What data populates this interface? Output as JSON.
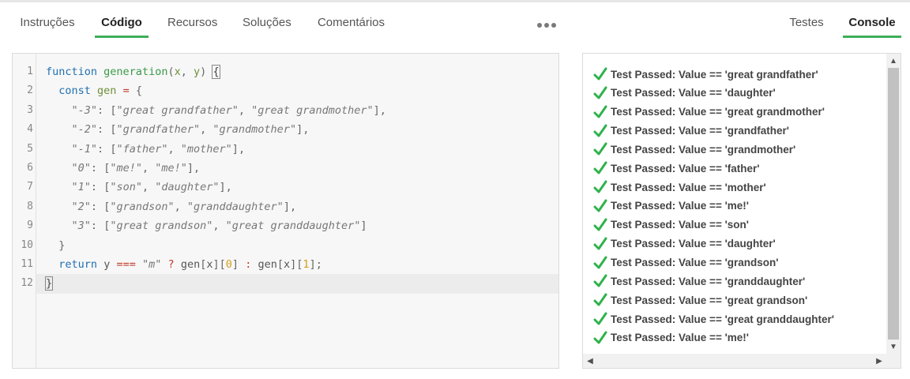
{
  "tabs_left": [
    {
      "label": "Instruções"
    },
    {
      "label": "Código"
    },
    {
      "label": "Recursos"
    },
    {
      "label": "Soluções"
    },
    {
      "label": "Comentários"
    }
  ],
  "tabs_right": [
    {
      "label": "Testes"
    },
    {
      "label": "Console"
    }
  ],
  "active_left_tab": "Código",
  "active_right_tab": "Console",
  "more_icon": "ellipsis-icon",
  "accent_color": "#3fae5a",
  "editor": {
    "line_numbers": [
      "1",
      "2",
      "3",
      "4",
      "5",
      "6",
      "7",
      "8",
      "9",
      "10",
      "11",
      "12"
    ],
    "current_line": 12,
    "lines": [
      "function generation(x, y) {",
      "  const gen = {",
      "    \"-3\": [\"great grandfather\", \"great grandmother\"],",
      "    \"-2\": [\"grandfather\", \"grandmother\"],",
      "    \"-1\": [\"father\", \"mother\"],",
      "    \"0\": [\"me!\", \"me!\"],",
      "    \"1\": [\"son\", \"daughter\"],",
      "    \"2\": [\"grandson\", \"granddaughter\"],",
      "    \"3\": [\"great grandson\", \"great granddaughter\"]",
      "  }",
      "  return y === \"m\" ? gen[x][0] : gen[x][1];",
      "}"
    ]
  },
  "console": {
    "results": [
      "Test Passed: Value == 'great grandfather'",
      "Test Passed: Value == 'daughter'",
      "Test Passed: Value == 'great grandmother'",
      "Test Passed: Value == 'grandfather'",
      "Test Passed: Value == 'grandmother'",
      "Test Passed: Value == 'father'",
      "Test Passed: Value == 'mother'",
      "Test Passed: Value == 'me!'",
      "Test Passed: Value == 'son'",
      "Test Passed: Value == 'daughter'",
      "Test Passed: Value == 'grandson'",
      "Test Passed: Value == 'granddaughter'",
      "Test Passed: Value == 'great grandson'",
      "Test Passed: Value == 'great granddaughter'",
      "Test Passed: Value == 'me!'"
    ],
    "check_icon": "check-icon",
    "check_color": "#2fb24c"
  }
}
